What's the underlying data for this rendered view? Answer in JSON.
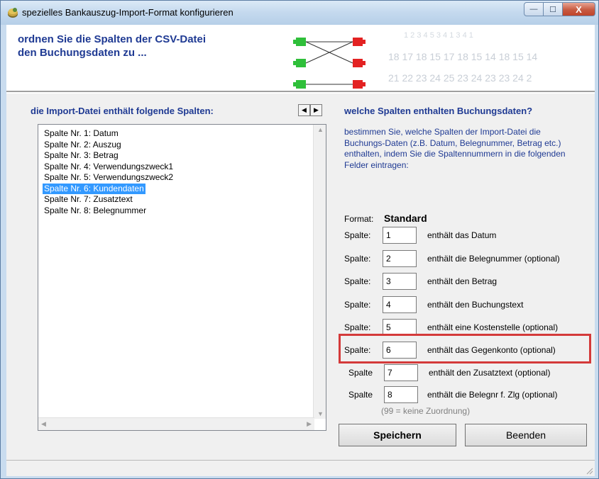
{
  "window": {
    "title": "spezielles Bankauszug-Import-Format konfigurieren",
    "min_glyph": "—",
    "max_glyph": "☐",
    "close_glyph": "X"
  },
  "banner": {
    "line1": "ordnen Sie die Spalten der CSV-Datei",
    "line2": "den Buchungsdaten zu ..."
  },
  "left_panel": {
    "header": "die Import-Datei enthält folgende Spalten:",
    "prev_arrow": "◀",
    "next_arrow": "▶",
    "items": [
      "Spalte Nr. 1: Datum",
      "Spalte Nr. 2: Auszug",
      "Spalte Nr. 3: Betrag",
      "Spalte Nr. 4: Verwendungszweck1",
      "Spalte Nr. 5: Verwendungszweck2",
      "Spalte Nr. 6: Kundendaten",
      "Spalte Nr. 7: Zusatztext",
      "Spalte Nr. 8: Belegnummer"
    ],
    "selected_index": 5
  },
  "right_panel": {
    "header": "welche Spalten enthalten Buchungsdaten?",
    "instruction": "bestimmen Sie, welche Spalten der Import-Datei die Buchungs-Daten (z.B. Datum, Belegnummer, Betrag etc.) enthalten, indem Sie die Spaltennummern in die folgenden Felder eintragen:",
    "format_label": "Format:",
    "format_value": "Standard",
    "rows": [
      {
        "label": "Spalte:",
        "value": "1",
        "desc": "enthält das Datum"
      },
      {
        "label": "Spalte:",
        "value": "2",
        "desc": "enthält die Belegnummer (optional)"
      },
      {
        "label": "Spalte:",
        "value": "3",
        "desc": "enthält den Betrag"
      },
      {
        "label": "Spalte:",
        "value": "4",
        "desc": "enthält den Buchungstext"
      },
      {
        "label": "Spalte:",
        "value": "5",
        "desc": "enthält eine Kostenstelle (optional)"
      },
      {
        "label": "Spalte:",
        "value": "6",
        "desc": "enthält das Gegenkonto (optional)"
      },
      {
        "label": "Spalte",
        "value": "7",
        "desc": "enthält den Zusatztext (optional)"
      },
      {
        "label": "Spalte",
        "value": "8",
        "desc": "enthält die Belegnr f. Zlg (optional)"
      }
    ],
    "highlighted_row": 5,
    "hint": "(99 = keine Zuordnung)"
  },
  "buttons": {
    "save": "Speichern",
    "quit": "Beenden"
  },
  "colors": {
    "heading_blue": "#1f3a93",
    "selection": "#3399ff",
    "highlight_red": "#d43a3a"
  }
}
